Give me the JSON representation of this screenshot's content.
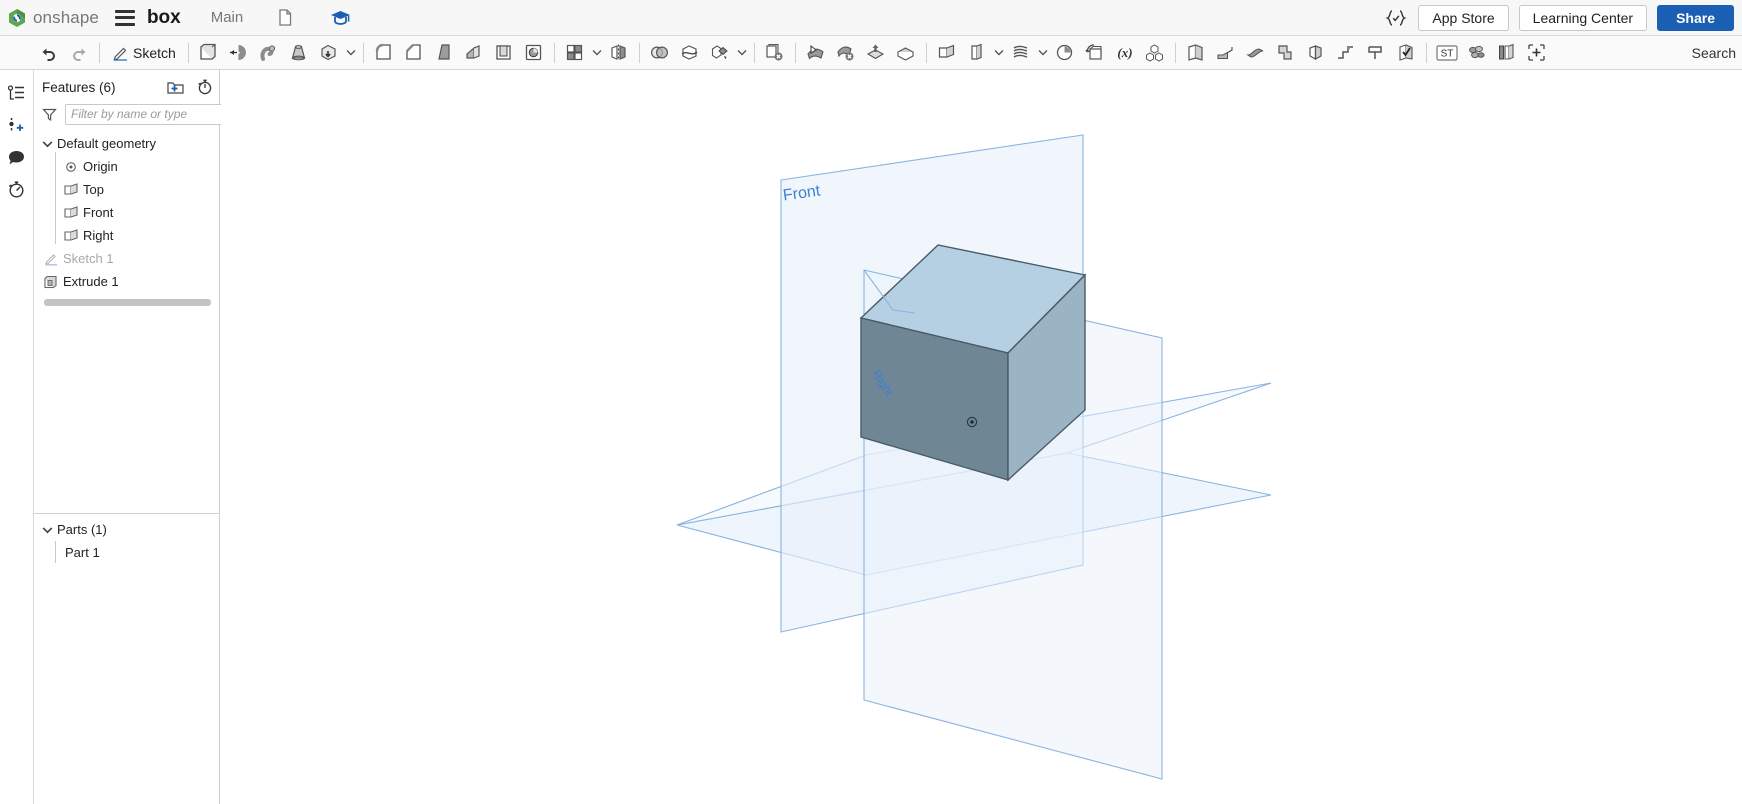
{
  "topbar": {
    "brand": "onshape",
    "logo_icon": "onshape-logo-icon",
    "menu_icon": "hamburger-menu-icon",
    "document_title": "box",
    "branch": "Main",
    "copy_icon": "copy-documents-icon",
    "learning_icon": "graduation-cap-icon",
    "featurescript_icon": "featurescript-braces-icon",
    "app_store_label": "App Store",
    "learning_center_label": "Learning Center",
    "share_label": "Share",
    "accent_color": "#1a5fb4"
  },
  "toolbar": {
    "undo_icon": "undo-arrow-icon",
    "redo_icon": "redo-arrow-icon",
    "sketch_label": "Sketch",
    "sketch_icon": "sketch-pencil-icon",
    "search_label": "Search",
    "tools": [
      {
        "name": "extrude-tool",
        "icon": "extrude-icon"
      },
      {
        "name": "revolve-tool",
        "icon": "revolve-icon"
      },
      {
        "name": "sweep-tool",
        "icon": "sweep-icon"
      },
      {
        "name": "loft-tool",
        "icon": "loft-icon"
      },
      {
        "name": "thicken-tool",
        "icon": "thicken-box-arrow-icon"
      },
      {
        "name": "fillet-tool",
        "icon": "fillet-icon"
      },
      {
        "name": "chamfer-tool",
        "icon": "chamfer-icon"
      },
      {
        "name": "draft-tool",
        "icon": "draft-icon"
      },
      {
        "name": "rib-tool",
        "icon": "rib-icon"
      },
      {
        "name": "shell-tool",
        "icon": "shell-icon"
      },
      {
        "name": "hole-tool",
        "icon": "hole-icon"
      },
      {
        "name": "pattern-tool",
        "icon": "linear-pattern-icon"
      },
      {
        "name": "mirror-tool",
        "icon": "mirror-icon"
      },
      {
        "name": "boolean-tool",
        "icon": "boolean-union-icon"
      },
      {
        "name": "split-tool",
        "icon": "split-icon"
      },
      {
        "name": "transform-tool",
        "icon": "transform-icon"
      },
      {
        "name": "delete-part-tool",
        "icon": "delete-part-icon"
      },
      {
        "name": "delete-face-tool",
        "icon": "delete-face-icon"
      },
      {
        "name": "move-face-tool",
        "icon": "move-face-icon"
      },
      {
        "name": "replace-face-tool",
        "icon": "replace-face-icon"
      },
      {
        "name": "enclose-tool",
        "icon": "enclose-icon"
      },
      {
        "name": "plane-tool",
        "icon": "construction-plane-icon"
      },
      {
        "name": "sketch-plane-tool",
        "icon": "sketch-plane-icon"
      },
      {
        "name": "curve-tool",
        "icon": "helix-curve-icon"
      },
      {
        "name": "clock-tool",
        "icon": "clock-icon"
      },
      {
        "name": "derive-tool",
        "icon": "derive-icon"
      },
      {
        "name": "variable-tool",
        "icon": "variable-x-icon"
      },
      {
        "name": "assembly-tool",
        "icon": "assembly-cubes-icon"
      },
      {
        "name": "sheetmetal-model-tool",
        "icon": "sheet-metal-model-icon"
      },
      {
        "name": "flange-tool",
        "icon": "flange-icon"
      },
      {
        "name": "bend-tool",
        "icon": "bend-icon"
      },
      {
        "name": "hem-tool",
        "icon": "hem-icon"
      },
      {
        "name": "tab-tool",
        "icon": "tab-icon"
      },
      {
        "name": "jog-tool",
        "icon": "jog-icon"
      },
      {
        "name": "corner-tool",
        "icon": "corner-icon"
      },
      {
        "name": "sheetmetal-check-tool",
        "icon": "sheet-metal-check-icon"
      },
      {
        "name": "standard-content-tool",
        "icon": "standard-content-st-icon"
      },
      {
        "name": "simulation-tool",
        "icon": "simulation-icon"
      },
      {
        "name": "render-tool",
        "icon": "render-icon"
      },
      {
        "name": "add-custom-tool",
        "icon": "add-toolbar-icon"
      }
    ]
  },
  "rail": {
    "items": [
      {
        "name": "feature-list-icon",
        "label": "Feature list"
      },
      {
        "name": "add-measurement-icon",
        "label": "Measure"
      },
      {
        "name": "comments-icon",
        "label": "Comments"
      },
      {
        "name": "history-icon",
        "label": "History"
      }
    ]
  },
  "panel": {
    "title": "Features (6)",
    "folder_icon": "new-folder-icon",
    "rollback_icon": "rollback-timer-icon",
    "filter_icon": "filter-funnel-icon",
    "filter_placeholder": "Filter by name or type",
    "expand_tab_icon": "panel-expand-icon",
    "tree": [
      {
        "name": "default-geometry",
        "label": "Default geometry",
        "type": "group",
        "expanded": true,
        "icon": "chevron-down-icon"
      },
      {
        "name": "origin",
        "label": "Origin",
        "type": "child",
        "icon": "origin-point-icon"
      },
      {
        "name": "plane-top",
        "label": "Top",
        "type": "child",
        "icon": "plane-icon"
      },
      {
        "name": "plane-front",
        "label": "Front",
        "type": "child",
        "icon": "plane-icon"
      },
      {
        "name": "plane-right",
        "label": "Right",
        "type": "child",
        "icon": "plane-icon"
      },
      {
        "name": "sketch-1",
        "label": "Sketch 1",
        "type": "feature",
        "icon": "sketch-pencil-icon",
        "dimmed": true
      },
      {
        "name": "extrude-1",
        "label": "Extrude 1",
        "type": "feature",
        "icon": "extrude-icon",
        "dimmed": false
      }
    ],
    "parts": {
      "title": "Parts (1)",
      "icon": "chevron-down-icon",
      "items": [
        {
          "name": "part-1",
          "label": "Part 1"
        }
      ]
    }
  },
  "viewport": {
    "plane_labels": [
      {
        "name": "front-plane-label",
        "text": "Front"
      },
      {
        "name": "right-plane-label",
        "text": "Right"
      }
    ],
    "colors": {
      "plane_fill": "#eaf2fb",
      "plane_stroke": "#8ab4e0",
      "part_top": "#a8c9e0",
      "part_front": "#6d8494",
      "part_side": "#92aebd",
      "part_edge": "#4a5a66",
      "label_color": "#3b7fd4"
    },
    "origin_marker": "origin-point-icon"
  }
}
